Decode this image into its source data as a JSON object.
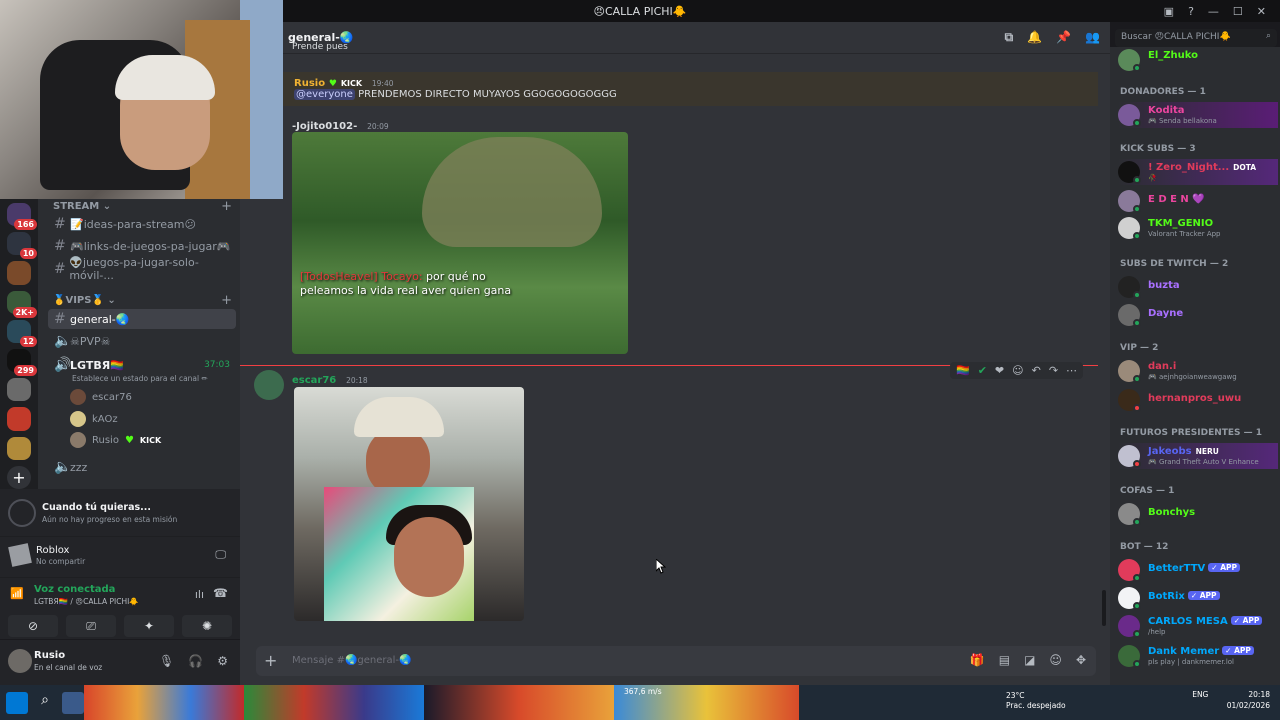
{
  "window": {
    "title": "😠CALLA PICHI🐥"
  },
  "rail": {
    "badges": [
      "166",
      "10",
      "",
      "2K+",
      "12",
      "299",
      "",
      "",
      ""
    ]
  },
  "channels": {
    "cat_stream": "STREAM ⌄",
    "stream_items": [
      "📝ideas-para-stream😕",
      "🎮links-de-juegos-pa-jugar🎮",
      "👽juegos-pa-jugar-solo-móvil-..."
    ],
    "cat_vips": "🥇VIPS🥇 ⌄",
    "general": "general-🌏",
    "pvp": "☠PVP☠",
    "voice_name": "LGTBЯ🏳️‍🌈",
    "voice_time": "37:03",
    "voice_status": "Establece un estado para el canal ✏",
    "voice_users": [
      "escar76",
      "kAOz",
      "Rusio"
    ],
    "zzz": "zzz"
  },
  "quest": {
    "title": "Cuando tú quieras...",
    "subtitle": "Aún no hay progreso en esta misión"
  },
  "activity": {
    "game": "Roblox",
    "status": "No compartir"
  },
  "voice": {
    "title": "Voz conectada",
    "subtitle": "LGTBЯ🏳️‍🌈 / 😠CALLA PICHI🐥"
  },
  "user": {
    "name": "Rusio",
    "status": "En el canal de voz"
  },
  "header": {
    "channel": "general-🌏",
    "search_placeholder": "Buscar 😠CALLA PICHI🐥"
  },
  "messages": {
    "top_fragment": "Prende pues",
    "m1_author": "Rusio",
    "m1_tag": "KICK",
    "m1_time": "19:40",
    "m1_mention": "@everyone",
    "m1_text": "PRENDEMOS DIRECTO MUYAYOS GGOGOGOGOGGG",
    "m2_author": "-Jojito0102-",
    "m2_time": "20:09",
    "m2_caption_red": "[TodosHeavel] Tocayo:",
    "m2_caption_1": "por qué no",
    "m2_caption_2": "peleamos la vida real aver quien gana",
    "m3_author": "escar76",
    "m3_time": "20:18"
  },
  "composer": {
    "placeholder": "Mensaje #🌏general-🌏"
  },
  "members": {
    "top": {
      "name": "El_Zhuko"
    },
    "sections": [
      {
        "title": "DONADORES — 1",
        "items": [
          {
            "name": "Kodita",
            "sub": "🎮 Senda bellakona",
            "color": "#eb459e"
          }
        ]
      },
      {
        "title": "KICK SUBS — 3",
        "items": [
          {
            "name": "! Zero_Night...",
            "sub": "🥀",
            "color": "#e13b5b",
            "tag": "DOTA"
          },
          {
            "name": "E D E N 💜",
            "sub": "",
            "color": "#eb459e"
          },
          {
            "name": "TKM_GENIO",
            "sub": "Valorant Tracker App",
            "color": "#53fc18"
          }
        ]
      },
      {
        "title": "SUBS DE TWITCH — 2",
        "items": [
          {
            "name": "buzta",
            "sub": "",
            "color": "#a970ff"
          },
          {
            "name": "Dayne",
            "sub": "",
            "color": "#a970ff"
          }
        ]
      },
      {
        "title": "VIP — 2",
        "items": [
          {
            "name": "dan.i",
            "sub": "🎮 aejnhgoianweawgawg",
            "color": "#e13b5b"
          },
          {
            "name": "hernanpros_uwu",
            "sub": "",
            "color": "#e13b5b"
          }
        ]
      },
      {
        "title": "FUTUROS PRESIDENTES — 1",
        "items": [
          {
            "name": "Jakeobs",
            "sub": "🎮 Grand Theft Auto V Enhance",
            "color": "#5865f2",
            "tag": "NERU"
          }
        ]
      },
      {
        "title": "COFAS — 1",
        "items": [
          {
            "name": "Bonchys",
            "sub": "",
            "color": "#53fc18"
          }
        ]
      },
      {
        "title": "BOT — 12",
        "items": [
          {
            "name": "BetterTTV",
            "sub": "",
            "color": "#00a8fc",
            "app": "✓ APP"
          },
          {
            "name": "BotRix",
            "sub": "",
            "color": "#00a8fc",
            "app": "✓ APP"
          },
          {
            "name": "CARLOS MESA",
            "sub": "/help",
            "color": "#00a8fc",
            "app": "✓ APP"
          },
          {
            "name": "Dank Memer",
            "sub": "pls play | dankmemer.lol",
            "color": "#00a8fc",
            "app": "✓ APP"
          }
        ]
      }
    ]
  },
  "taskbar": {
    "temp": "23°C",
    "weather": "Prac. despejado",
    "lang": "ENG",
    "time": "20:18",
    "date": "01/02/2026",
    "speed": "367,6 m/s"
  },
  "colors": {
    "accent": "#5865f2",
    "online": "#23a55a",
    "kick": "#53fc18",
    "mention_bar": "#f0b232"
  }
}
